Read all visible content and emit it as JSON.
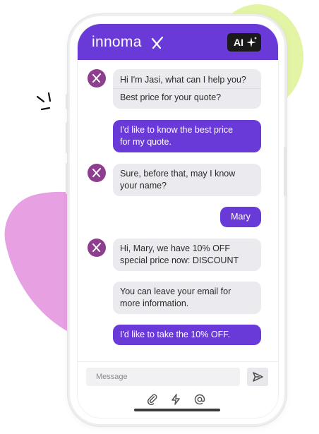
{
  "header": {
    "brand": "innoma",
    "ai_badge": "AI"
  },
  "messages": [
    {
      "sender": "bot",
      "lines": [
        "Hi I'm Jasi, what can I help you?"
      ],
      "quick_reply": "Best price for your quote?"
    },
    {
      "sender": "user",
      "lines": [
        "I'd like to know the best price",
        "for my quote."
      ]
    },
    {
      "sender": "bot",
      "lines": [
        "Sure, before that, may I know",
        "your name?"
      ]
    },
    {
      "sender": "user",
      "lines": [
        "Mary"
      ]
    },
    {
      "sender": "bot",
      "lines": [
        "Hi, Mary, we have 10% OFF",
        "special price now: DISCOUNT"
      ]
    },
    {
      "sender": "bot",
      "lines": [
        "You can leave your email for",
        "more information."
      ]
    },
    {
      "sender": "user",
      "lines": [
        "I'd like to take the 10% OFF."
      ]
    }
  ],
  "composer": {
    "placeholder": "Message",
    "icons": [
      "paperclip-icon",
      "lightning-icon",
      "at-sign-icon"
    ]
  },
  "colors": {
    "accent": "#6a3ad8",
    "bot_bubble": "#ebebef",
    "avatar": "#8e3e8e",
    "blob_green": "#e3f5a4",
    "blob_pink": "#e7a1e2"
  }
}
